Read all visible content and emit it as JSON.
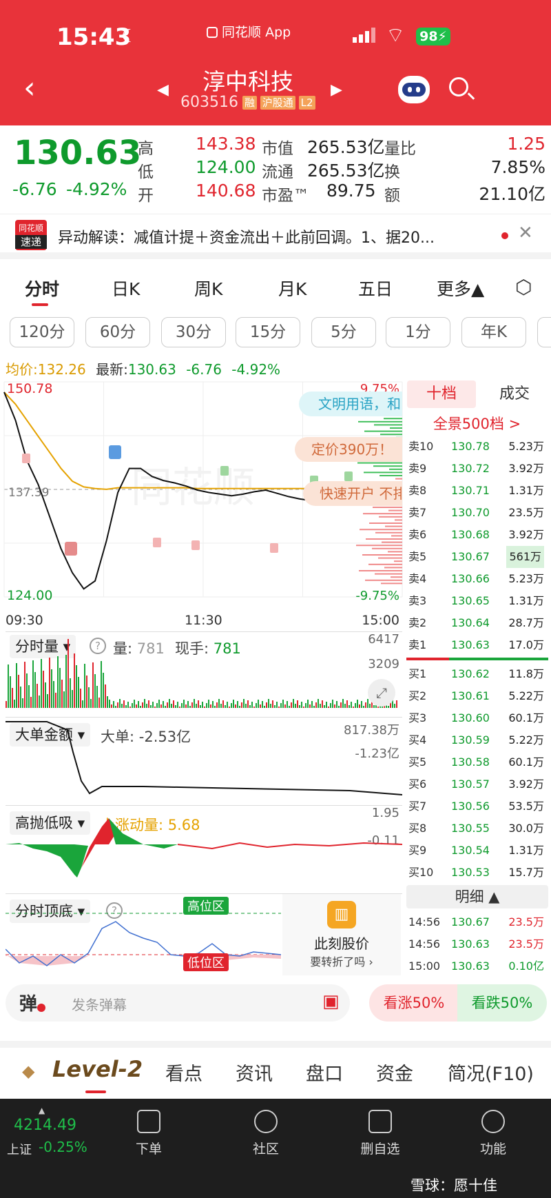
{
  "status_bar": {
    "time": "15:43",
    "app_name": "同花顺 App",
    "battery": "98"
  },
  "header": {
    "stock_name": "淳中科技",
    "stock_code": "603516",
    "tags": [
      "融",
      "沪股通",
      "L2"
    ]
  },
  "quote": {
    "price": "130.63",
    "change": "-6.76",
    "change_pct": "-4.92%",
    "high_label": "高",
    "high": "143.38",
    "low_label": "低",
    "low": "124.00",
    "open_label": "开",
    "open": "140.68",
    "mktcap_label": "市值",
    "mktcap": "265.53亿",
    "float_label": "流通",
    "float": "265.53亿",
    "pe_label": "市盈™",
    "pe": "89.75",
    "vol_ratio_label": "量比",
    "vol_ratio": "1.25",
    "turnover_label": "换",
    "turnover": "7.85%",
    "amount_label": "额",
    "amount": "21.10亿"
  },
  "news": {
    "logo_top": "同花顺",
    "logo_bottom": "速递",
    "text": "异动解读：减值计提＋资金流出＋此前回调。1、据20..."
  },
  "tabs": [
    "分时",
    "日K",
    "周K",
    "月K",
    "五日",
    "更多▲"
  ],
  "periods": [
    "120分",
    "60分",
    "30分",
    "15分",
    "5分",
    "1分",
    "年K"
  ],
  "info_line": {
    "avg_label": "均价:",
    "avg": "132.26",
    "latest_label": "最新:",
    "latest": "130.63",
    "change": "-6.76",
    "change_pct": "-4.92%"
  },
  "chart": {
    "y_max": "150.78",
    "y_min": "124.00",
    "pct_max": "9.75%",
    "pct_min": "-9.75%",
    "prev_close": "137.39",
    "times": [
      "09:30",
      "11:30",
      "15:00"
    ],
    "bubbles": [
      "文明用语，和",
      "定价390万！",
      "快速开户 不排"
    ],
    "watermark": "同花顺"
  },
  "chart_data": {
    "type": "line",
    "title": "",
    "series": [
      {
        "name": "最新",
        "values": [
          149.5,
          146,
          141,
          138,
          134,
          130,
          127,
          125,
          126,
          131,
          137,
          140,
          140,
          139,
          138.5,
          138.2,
          137.8,
          137.3,
          137,
          136.8,
          136.6,
          136.8,
          137.1,
          137.3,
          136.9,
          136.5,
          136.2,
          136,
          135.9,
          136,
          136.3,
          136.4,
          136.6,
          136.5,
          136.4,
          136.3
        ]
      },
      {
        "name": "均价",
        "values": [
          149.5,
          148,
          146,
          144,
          142,
          140,
          138.4,
          137.7,
          137.5,
          137.4,
          137.6,
          137.6,
          137.6,
          137.6,
          137.6,
          137.6,
          137.6,
          137.5,
          137.5,
          137.5,
          137.5,
          137.5,
          137.5,
          137.5,
          137.5,
          137.5,
          137.5,
          137.5,
          137.5,
          137.5,
          137.5,
          137.5,
          137.5,
          137.5,
          137.5,
          137.4
        ]
      }
    ],
    "ylim": [
      124.0,
      150.78
    ]
  },
  "volume_panel": {
    "label": "分时量",
    "vol_label": "量:",
    "vol": "781",
    "hand_label": "现手:",
    "hand": "781",
    "max": "6417",
    "mid": "3209"
  },
  "bigorder_panel": {
    "label": "大单金额",
    "value_label": "大单:",
    "value": "-2.53亿",
    "max": "817.38万",
    "min": "-1.23亿"
  },
  "gaopao_panel": {
    "label": "高抛低吸",
    "value_label": "上涨动量:",
    "value": "5.68",
    "max": "1.95",
    "min": "-0.11"
  },
  "topbottom_panel": {
    "label": "分时顶底",
    "high_zone": "高位区",
    "low_zone": "低位区",
    "ad_line1": "此刻股价",
    "ad_line2": "要转折了吗"
  },
  "book": {
    "tab_ten": "十档",
    "tab_trade": "成交",
    "panorama": "全景500档 >",
    "sells": [
      {
        "label": "卖10",
        "price": "130.78",
        "vol": "5.23万"
      },
      {
        "label": "卖9",
        "price": "130.72",
        "vol": "3.92万"
      },
      {
        "label": "卖8",
        "price": "130.71",
        "vol": "1.31万"
      },
      {
        "label": "卖7",
        "price": "130.70",
        "vol": "23.5万"
      },
      {
        "label": "卖6",
        "price": "130.68",
        "vol": "3.92万"
      },
      {
        "label": "卖5",
        "price": "130.67",
        "vol": "561万"
      },
      {
        "label": "卖4",
        "price": "130.66",
        "vol": "5.23万"
      },
      {
        "label": "卖3",
        "price": "130.65",
        "vol": "1.31万"
      },
      {
        "label": "卖2",
        "price": "130.64",
        "vol": "28.7万"
      },
      {
        "label": "卖1",
        "price": "130.63",
        "vol": "17.0万"
      }
    ],
    "buys": [
      {
        "label": "买1",
        "price": "130.62",
        "vol": "11.8万"
      },
      {
        "label": "买2",
        "price": "130.61",
        "vol": "5.22万"
      },
      {
        "label": "买3",
        "price": "130.60",
        "vol": "60.1万"
      },
      {
        "label": "买4",
        "price": "130.59",
        "vol": "5.22万"
      },
      {
        "label": "买5",
        "price": "130.58",
        "vol": "60.1万"
      },
      {
        "label": "买6",
        "price": "130.57",
        "vol": "3.92万"
      },
      {
        "label": "买7",
        "price": "130.56",
        "vol": "53.5万"
      },
      {
        "label": "买8",
        "price": "130.55",
        "vol": "30.0万"
      },
      {
        "label": "买9",
        "price": "130.54",
        "vol": "1.31万"
      },
      {
        "label": "买10",
        "price": "130.53",
        "vol": "15.7万"
      }
    ],
    "detail_label": "明细 ▲",
    "details": [
      {
        "time": "14:56",
        "price": "130.67",
        "vol": "23.5万"
      },
      {
        "time": "14:56",
        "price": "130.63",
        "vol": "23.5万"
      },
      {
        "time": "15:00",
        "price": "130.63",
        "vol": "0.10亿"
      }
    ]
  },
  "danmu": {
    "icon": "弹",
    "placeholder": "发条弹幕",
    "up_vote": "看涨50%",
    "down_vote": "看跌50%"
  },
  "bottom_tabs": [
    "Level-2",
    "看点",
    "资讯",
    "盘口",
    "资金",
    "简况(F10)"
  ],
  "nav": {
    "index_value": "4214.49",
    "index_name": "上证",
    "index_change": "-0.25%",
    "items": [
      "下单",
      "社区",
      "删自选",
      "功能"
    ],
    "watermark": "雪球：愿十佳"
  }
}
